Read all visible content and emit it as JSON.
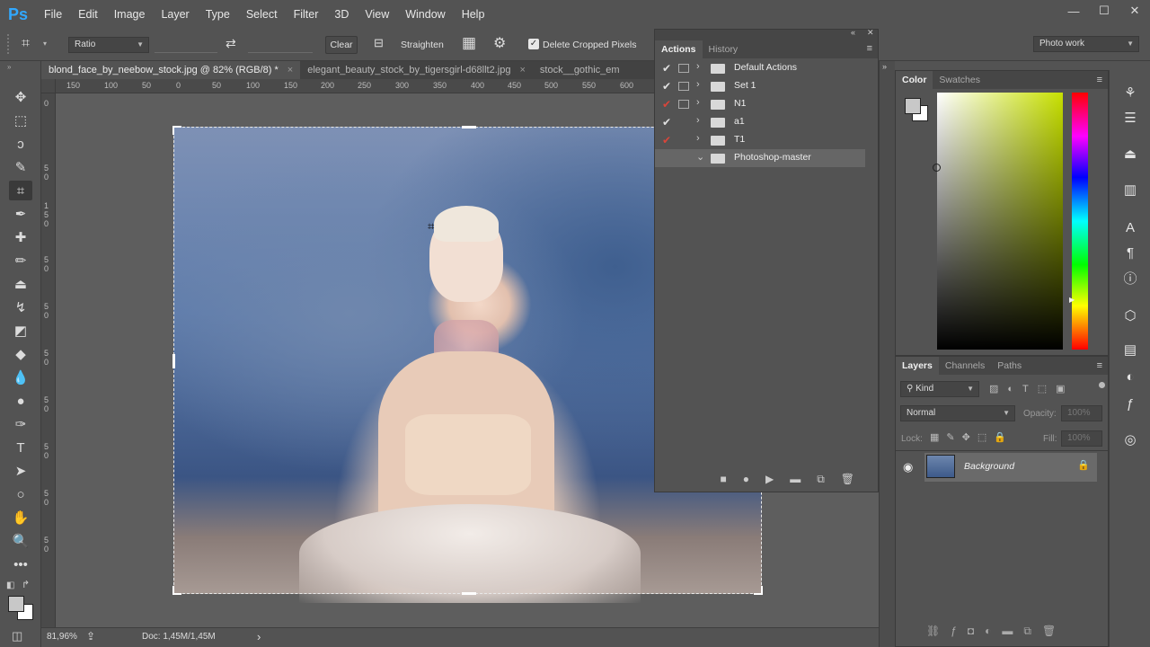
{
  "app": {
    "logo": "Ps"
  },
  "menu": [
    "File",
    "Edit",
    "Image",
    "Layer",
    "Type",
    "Select",
    "Filter",
    "3D",
    "View",
    "Window",
    "Help"
  ],
  "window_controls": {
    "minimize": "—",
    "maximize": "☐",
    "close": "✕"
  },
  "options": {
    "ratio_label": "Ratio",
    "clear_label": "Clear",
    "straighten_label": "Straighten",
    "delete_cropped_label": "Delete Cropped Pixels",
    "delete_cropped_checked": true,
    "workspace": "Photo work"
  },
  "tabs": [
    {
      "label": "blond_face_by_neebow_stock.jpg @ 82% (RGB/8) *",
      "close": "×"
    },
    {
      "label": "elegant_beauty_stock_by_tigersgirl-d68llt2.jpg",
      "close": "×"
    },
    {
      "label": "stock__gothic_em",
      "close": ""
    }
  ],
  "ruler": {
    "h_ticks": [
      "150",
      "100",
      "50",
      "0",
      "50",
      "100",
      "150",
      "200",
      "250",
      "300",
      "350",
      "400",
      "450",
      "500",
      "550",
      "600"
    ],
    "v_ticks": [
      "0",
      "5",
      "0",
      "1",
      "5",
      "0",
      "5",
      "0",
      "5",
      "0",
      "5",
      "0",
      "5",
      "0",
      "5",
      "0",
      "5",
      "0",
      "5",
      "0"
    ]
  },
  "status": {
    "zoom": "81,96%",
    "doc": "Doc: 1,45M/1,45M",
    "arrow": "›"
  },
  "actions": {
    "tabs": [
      "Actions",
      "History"
    ],
    "rows": [
      {
        "check": "✔",
        "check_color": "#e0e0e0",
        "dialog": true,
        "name": "Default Actions"
      },
      {
        "check": "✔",
        "check_color": "#e0e0e0",
        "dialog": true,
        "name": "Set 1"
      },
      {
        "check": "✔",
        "check_color": "#d9453a",
        "dialog": true,
        "name": "N1"
      },
      {
        "check": "✔",
        "check_color": "#e0e0e0",
        "dialog": false,
        "name": "a1"
      },
      {
        "check": "✔",
        "check_color": "#d9453a",
        "dialog": false,
        "name": "T1"
      },
      {
        "check": "",
        "check_color": "#e0e0e0",
        "dialog": false,
        "name": "Photoshop-master"
      }
    ],
    "footer": [
      "■",
      "●",
      "▶",
      "▬",
      "⧉",
      "🗑"
    ]
  },
  "color": {
    "tabs": [
      "Color",
      "Swatches"
    ]
  },
  "layers": {
    "tabs": [
      "Layers",
      "Channels",
      "Paths"
    ],
    "kind": "Kind",
    "blend": "Normal",
    "opacity_label": "Opacity:",
    "opacity_value": "100%",
    "lock_label": "Lock:",
    "fill_label": "Fill:",
    "fill_value": "100%",
    "layer_name": "Background"
  }
}
